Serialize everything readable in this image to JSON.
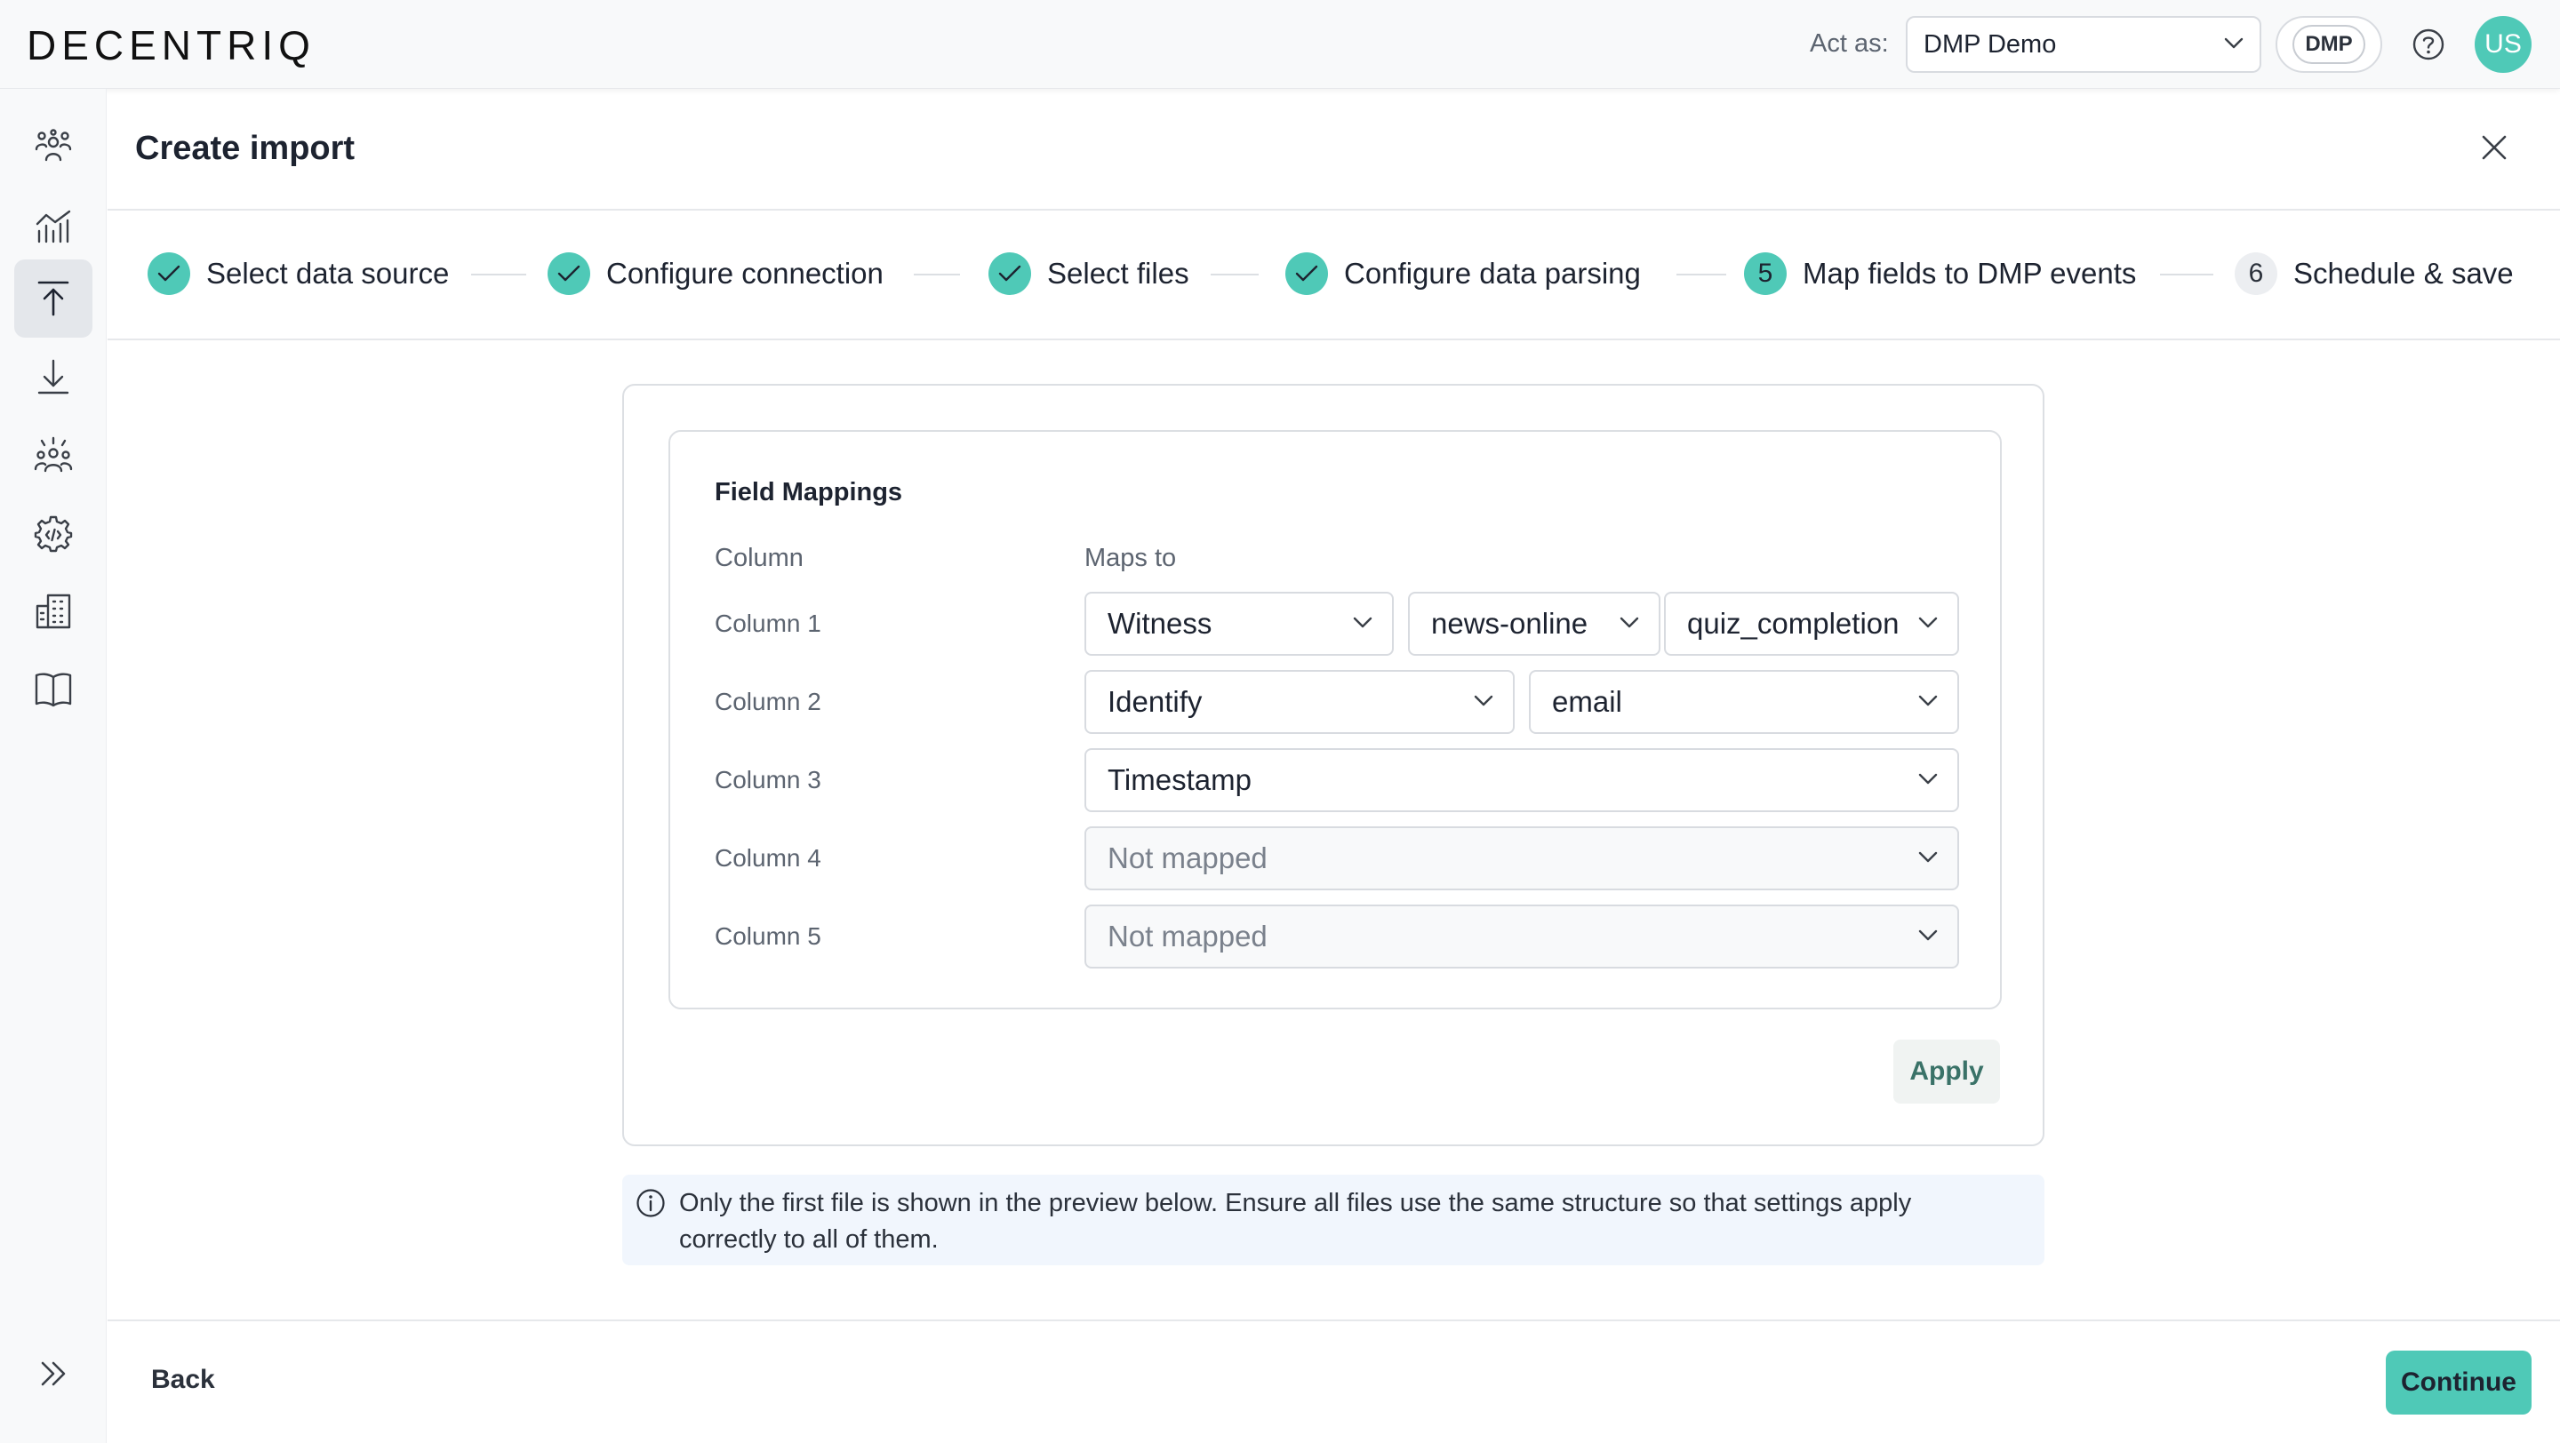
{
  "app": {
    "logo": "DECENTRIQ"
  },
  "header": {
    "act_as_label": "Act as:",
    "act_as_value": "DMP Demo",
    "dmp_badge": "DMP",
    "avatar_initials": "US"
  },
  "sidebar": {
    "icons": [
      "people-icon",
      "analytics-icon",
      "upload-icon",
      "download-icon",
      "audience-icon",
      "settings-code-icon",
      "building-icon",
      "book-icon"
    ],
    "active": "upload-icon",
    "expand_icon": "double-chevron-right-icon"
  },
  "page": {
    "title": "Create import"
  },
  "stepper": {
    "steps": [
      {
        "label": "Select data source",
        "marker": "",
        "state": "done"
      },
      {
        "label": "Configure connection",
        "marker": "",
        "state": "done"
      },
      {
        "label": "Select files",
        "marker": "",
        "state": "done"
      },
      {
        "label": "Configure data parsing",
        "marker": "",
        "state": "done"
      },
      {
        "label": "Map fields to DMP events",
        "marker": "5",
        "state": "active"
      },
      {
        "label": "Schedule & save",
        "marker": "6",
        "state": "pending"
      }
    ]
  },
  "field_mappings": {
    "title": "Field Mappings",
    "column_header": "Column",
    "maps_to_header": "Maps to",
    "rows": [
      {
        "column": "Column 1",
        "mappings": [
          "Witness",
          "news-online",
          "quiz_completion"
        ]
      },
      {
        "column": "Column 2",
        "mappings": [
          "Identify",
          "email"
        ]
      },
      {
        "column": "Column 3",
        "mappings": [
          "Timestamp"
        ]
      },
      {
        "column": "Column 4",
        "mappings": [
          "Not mapped"
        ]
      },
      {
        "column": "Column 5",
        "mappings": [
          "Not mapped"
        ]
      }
    ],
    "apply_label": "Apply"
  },
  "info": {
    "text": "Only the first file is shown in the preview below. Ensure all files use the same structure so that settings apply correctly to all of them."
  },
  "footer": {
    "back_label": "Back",
    "continue_label": "Continue"
  },
  "colors": {
    "accent": "#4fc9b7",
    "border": "#dcdfe3",
    "info_bg": "#f1f6fd"
  }
}
